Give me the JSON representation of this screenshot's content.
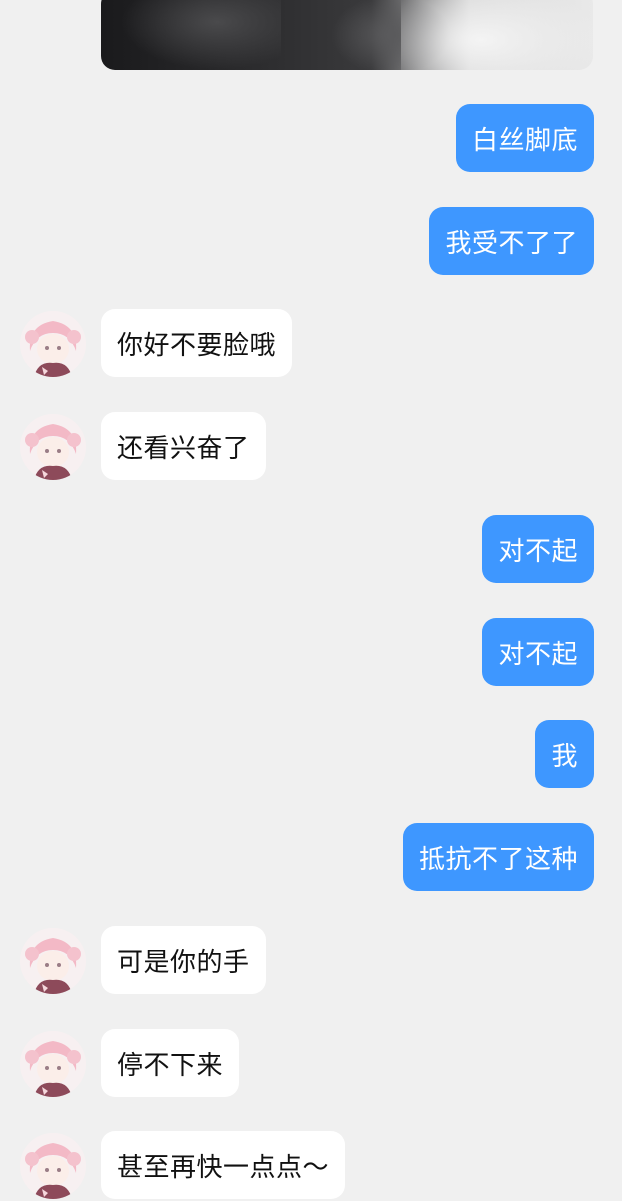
{
  "messages": [
    {
      "side": "me",
      "text": "白丝脚底"
    },
    {
      "side": "me",
      "text": "我受不了了"
    },
    {
      "side": "them",
      "text": "你好不要脸哦"
    },
    {
      "side": "them",
      "text": "还看兴奋了"
    },
    {
      "side": "me",
      "text": "对不起"
    },
    {
      "side": "me",
      "text": "对不起"
    },
    {
      "side": "me",
      "text": "我"
    },
    {
      "side": "me",
      "text": "抵抗不了这种"
    },
    {
      "side": "them",
      "text": "可是你的手"
    },
    {
      "side": "them",
      "text": "停不下来"
    },
    {
      "side": "them",
      "text": "甚至再快一点点～"
    }
  ],
  "colors": {
    "background": "#f0f0f0",
    "my_bubble": "#3e97ff",
    "their_bubble": "#ffffff"
  },
  "icons": {
    "avatar": "anime-girl-avatar"
  }
}
